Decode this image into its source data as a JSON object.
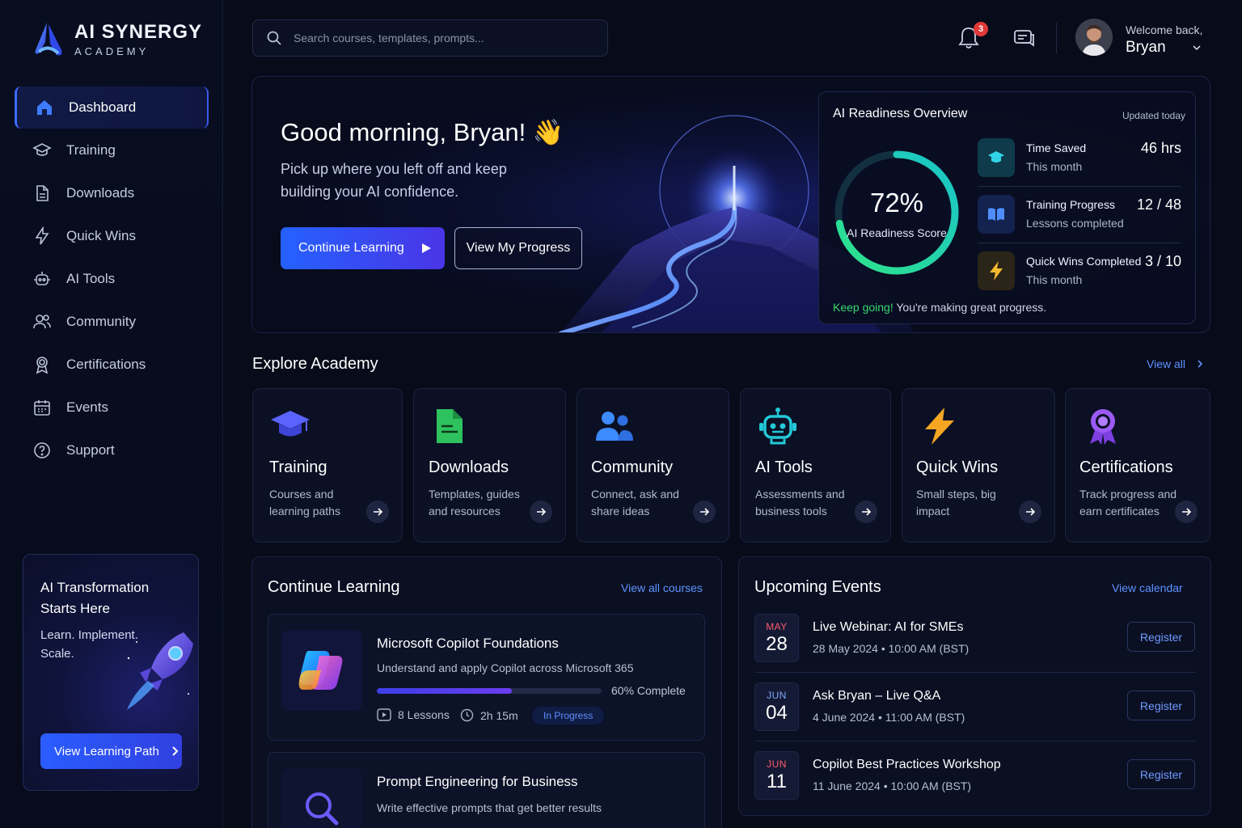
{
  "brand": {
    "title": "AI SYNERGY",
    "subtitle": "ACADEMY"
  },
  "sidebar": {
    "items": [
      {
        "label": "Dashboard",
        "icon": "home-icon",
        "active": true
      },
      {
        "label": "Training",
        "icon": "graduation-cap-icon"
      },
      {
        "label": "Downloads",
        "icon": "document-icon"
      },
      {
        "label": "Quick Wins",
        "icon": "lightning-icon"
      },
      {
        "label": "AI Tools",
        "icon": "robot-icon"
      },
      {
        "label": "Community",
        "icon": "users-icon"
      },
      {
        "label": "Certifications",
        "icon": "badge-icon"
      },
      {
        "label": "Events",
        "icon": "calendar-icon"
      },
      {
        "label": "Support",
        "icon": "help-icon"
      }
    ],
    "promo": {
      "title": "AI Transformation Starts Here",
      "subtitle": "Learn. Implement. Scale.",
      "button": "View Learning Path"
    }
  },
  "topbar": {
    "search_placeholder": "Search courses, templates, prompts...",
    "notifications": "3",
    "welcome": "Welcome back,",
    "user": "Bryan"
  },
  "hero": {
    "title": "Good morning, Bryan! 👋",
    "subtitle": "Pick up where you left off and keep building your AI confidence.",
    "primary_button": "Continue Learning",
    "secondary_button": "View My Progress"
  },
  "readiness": {
    "title": "AI Readiness Overview",
    "updated": "Updated today",
    "score": "72%",
    "score_fraction": 0.72,
    "score_label": "AI Readiness Score",
    "stats": [
      {
        "label": "Time Saved",
        "sub": "This month",
        "value": "46 hrs",
        "icon": "graduation-cap-icon"
      },
      {
        "label": "Training Progress",
        "sub": "Lessons completed",
        "value": "12 / 48",
        "icon": "book-icon"
      },
      {
        "label": "Quick Wins Completed",
        "sub": "This month",
        "value": "3 / 10",
        "icon": "lightning-icon"
      }
    ],
    "keep_bold": "Keep going!",
    "keep_rest": " You're making great progress."
  },
  "explore": {
    "title": "Explore Academy",
    "view_all": "View all",
    "cards": [
      {
        "title": "Training",
        "desc": "Courses and learning paths"
      },
      {
        "title": "Downloads",
        "desc": "Templates, guides and resources"
      },
      {
        "title": "Community",
        "desc": "Connect, ask and share ideas"
      },
      {
        "title": "AI Tools",
        "desc": "Assessments and business tools"
      },
      {
        "title": "Quick Wins",
        "desc": "Small steps, big impact"
      },
      {
        "title": "Certifications",
        "desc": "Track progress and earn certificates"
      }
    ]
  },
  "continue": {
    "title": "Continue Learning",
    "view_all": "View all courses",
    "courses": [
      {
        "title": "Microsoft Copilot Foundations",
        "desc": "Understand and apply Copilot across Microsoft 365",
        "progress": 0.6,
        "progress_text": "60% Complete",
        "lessons": "8 Lessons",
        "duration": "2h 15m",
        "status": "In Progress"
      },
      {
        "title": "Prompt Engineering for Business",
        "desc": "Write effective prompts that get better results"
      }
    ]
  },
  "events": {
    "title": "Upcoming Events",
    "view_all": "View calendar",
    "items": [
      {
        "month": "MAY",
        "day": "28",
        "title": "Live Webinar: AI for SMEs",
        "date": "28 May 2024  •  10:00 AM (BST)",
        "button": "Register",
        "month_color": "#ff5a6e"
      },
      {
        "month": "JUN",
        "day": "04",
        "title": "Ask Bryan – Live Q&A",
        "date": "4 June 2024  •  11:00 AM (BST)",
        "button": "Register",
        "month_color": "#7fa8ff"
      },
      {
        "month": "JUN",
        "day": "11",
        "title": "Copilot Best Practices Workshop",
        "date": "11 June 2024  •  10:00 AM (BST)",
        "button": "Register",
        "month_color": "#ff5a6e"
      }
    ]
  }
}
